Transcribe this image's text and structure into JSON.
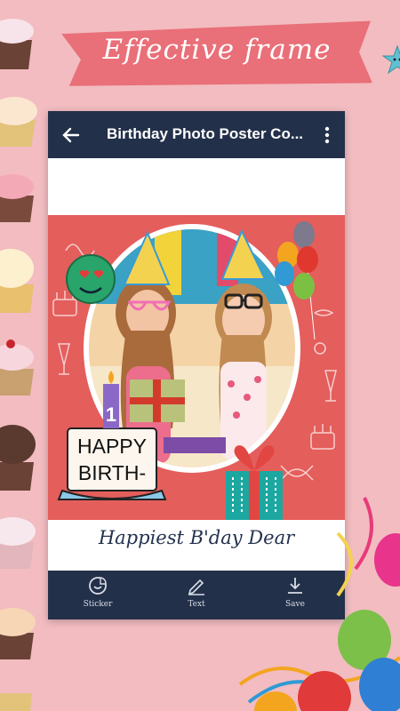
{
  "banner": {
    "title": "Effective frame"
  },
  "app_bar": {
    "title": "Birthday Photo Poster Co..."
  },
  "poster": {
    "cake_text_line1": "HAPPY",
    "cake_text_line2": "BIRTH-",
    "candle_number": "1",
    "caption": "Happiest B'day Dear"
  },
  "bottom_bar": {
    "items": [
      {
        "label": "Sticker",
        "icon": "sticker-icon"
      },
      {
        "label": "Text",
        "icon": "pencil-icon"
      },
      {
        "label": "Save",
        "icon": "download-icon"
      }
    ]
  },
  "colors": {
    "background": "#f2bcc0",
    "ribbon": "#e96f78",
    "app_bar": "#22304a",
    "poster": "#e45e5c"
  }
}
